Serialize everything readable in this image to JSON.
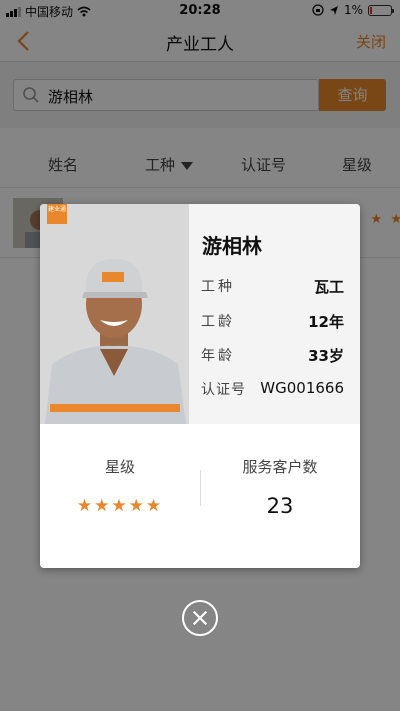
{
  "status_bar": {
    "carrier": "中国移动",
    "time": "20:28",
    "battery": "1%"
  },
  "nav": {
    "title": "产业工人",
    "close_label": "关闭"
  },
  "search": {
    "value": "游相林",
    "button_label": "查询"
  },
  "table_header": {
    "name": "姓名",
    "trade": "工种",
    "cert_no": "认证号",
    "rating": "星级"
  },
  "list": [
    {
      "stars": "★ ★"
    }
  ],
  "card": {
    "logo_text": "建业通",
    "name": "游相林",
    "fields": [
      {
        "label": "工种",
        "value": "瓦工"
      },
      {
        "label": "工龄",
        "value": "12年"
      },
      {
        "label": "年龄",
        "value": "33岁"
      },
      {
        "label": "认证号",
        "value": "WG001666"
      }
    ],
    "rating_label": "星级",
    "stars": "★★★★★",
    "rating_value": 5,
    "customers_label": "服务客户数",
    "customers_value": "23"
  },
  "colors": {
    "accent": "#e8872b",
    "overlay": "rgba(0,0,0,0.48)"
  },
  "icons": [
    "signal-icon",
    "wifi-icon",
    "back-icon",
    "search-icon",
    "lock-rotation-icon",
    "location-icon",
    "battery-icon",
    "close-icon",
    "star-icon"
  ]
}
